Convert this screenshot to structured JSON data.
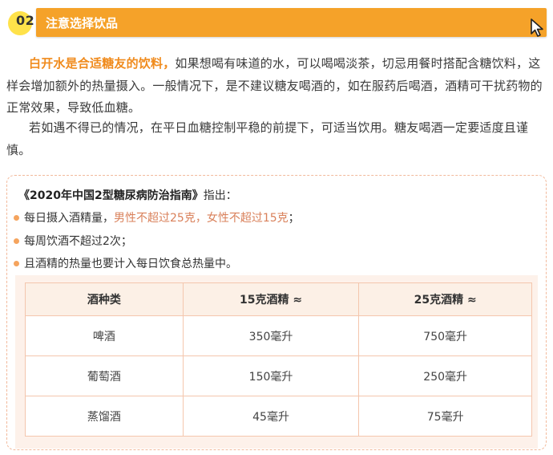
{
  "section": {
    "number": "02",
    "title": "注意选择饮品"
  },
  "paragraph1": {
    "highlight": "白开水是合适糖友的饮料，",
    "rest": "如果想喝有味道的水，可以喝喝淡茶，切忌用餐时搭配含糖饮料，这样会增加额外的热量摄入。一般情况下，是不建议糖友喝酒的，如在服药后喝酒，酒精可干扰药物的正常效果，导致低血糖。"
  },
  "paragraph2": {
    "text": "若如遇不得已的情况，在平日血糖控制平稳的前提下，可适当饮用。糖友喝酒一定要适度且谨慎。"
  },
  "guide": {
    "title_bold": "《2020年中国2型糖尿病防治指南》",
    "title_rest": "指出：",
    "bullets": [
      {
        "text": "每日摄入酒精量，",
        "highlight": "男性不超过25克，女性不超过15克",
        "suffix": "；"
      },
      {
        "text": "每周饮酒不超过2次；"
      },
      {
        "text": "且酒精的热量也要计入每日饮食总热量中。"
      }
    ]
  },
  "table": {
    "headers": [
      "酒种类",
      "15克酒精 ≈",
      "25克酒精 ≈"
    ],
    "rows": [
      [
        "啤酒",
        "350毫升",
        "750毫升"
      ],
      [
        "葡萄酒",
        "150毫升",
        "250毫升"
      ],
      [
        "蒸馏酒",
        "45毫升",
        "75毫升"
      ]
    ]
  },
  "colors": {
    "accent_bar": "#f5a229",
    "number_circle": "#ffe24a",
    "highlight_text": "#f08b1d",
    "bullet_dot": "#f5a45e",
    "table_border": "#f4c6ad"
  },
  "icons": {
    "cursor": "mouse-pointer-icon"
  }
}
